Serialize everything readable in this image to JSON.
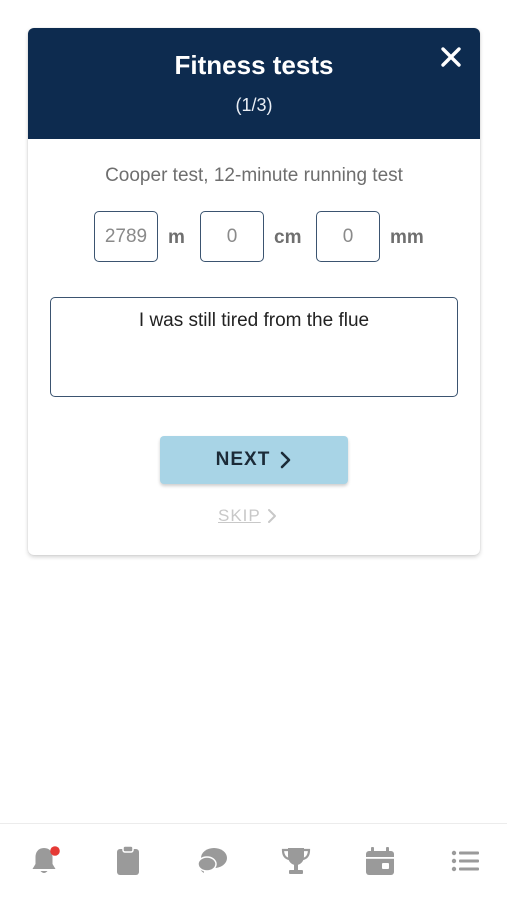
{
  "dialog": {
    "title": "Fitness tests",
    "step": "(1/3)",
    "close_icon": "close-icon"
  },
  "test": {
    "name": "Cooper test, 12-minute running test",
    "fields": [
      {
        "value": "2789",
        "unit": "m"
      },
      {
        "value": "0",
        "unit": "cm"
      },
      {
        "value": "0",
        "unit": "mm"
      }
    ],
    "comment": "I was still tired from the flue"
  },
  "actions": {
    "next_label": "NEXT",
    "skip_label": "SKIP"
  },
  "nav": {
    "items": [
      {
        "icon": "bell-icon",
        "has_notification": true
      },
      {
        "icon": "clipboard-icon"
      },
      {
        "icon": "chat-icon"
      },
      {
        "icon": "trophy-icon"
      },
      {
        "icon": "calendar-icon"
      },
      {
        "icon": "menu-list-icon"
      }
    ],
    "colors": {
      "icon": "#9a9a9a",
      "notification": "#e53935"
    }
  },
  "colors": {
    "header": "#0d2b4f",
    "next_button": "#a8d4e6",
    "field_border": "#3b5470"
  }
}
